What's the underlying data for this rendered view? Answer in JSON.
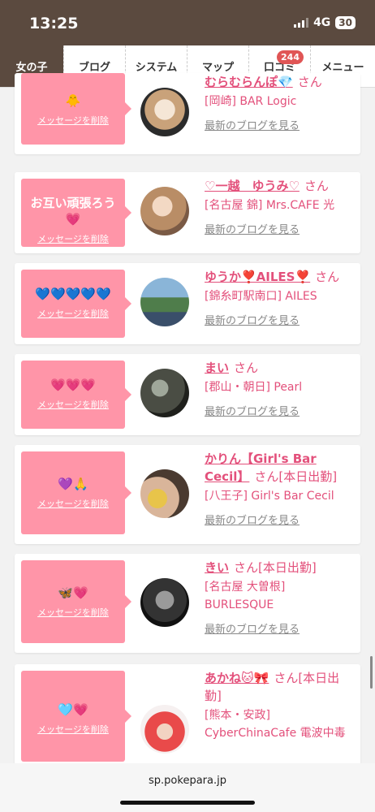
{
  "status_bar": {
    "time": "13:25",
    "network": "4G",
    "battery": "30"
  },
  "nav": {
    "tabs": [
      "女の子",
      "ブログ",
      "システム",
      "マップ",
      "口コミ",
      "メニュー"
    ],
    "review_badge": "244"
  },
  "delete_label": "メッセージを削除",
  "blog_label": "最新のブログを見る",
  "entries": [
    {
      "message": "🐥",
      "name": "むらむらんぽ💎",
      "san": "さん",
      "shop": "[岡崎] BAR Logic"
    },
    {
      "message": "お互い頑張ろう💗",
      "name": "♡一越　ゆうみ♡",
      "san": "さん",
      "shop": "[名古屋 錦] Mrs.CAFE 光"
    },
    {
      "message": "💙💙💙💙💙",
      "name": "ゆうか❣️AILES❣️",
      "san": "さん",
      "shop": "[錦糸町駅南口] AILES"
    },
    {
      "message": "💗💗💗",
      "name": "まい",
      "san": "さん",
      "shop": "[郡山・朝日] Pearl"
    },
    {
      "message": "💜🙏",
      "name": "かりん【Girl's Bar Cecil】",
      "san": "さん[本日出勤]",
      "shop": "[八王子] Girl's Bar Cecil"
    },
    {
      "message": "🦋💗",
      "name": "きい",
      "san": "さん[本日出勤]",
      "shop": "[名古屋 大曽根] BURLESQUE"
    },
    {
      "message": "🩵💗",
      "name": "あかね🐱🎀",
      "san": "さん[本日出勤]",
      "shop": "[熊本・安政] CyberChinaCafe 電波中毒"
    }
  ],
  "url": "sp.pokepara.jp",
  "colors": {
    "brand_brown": "#5b4a3f",
    "bubble_pink": "#ff95a8",
    "name_pink": "#e3507b"
  }
}
